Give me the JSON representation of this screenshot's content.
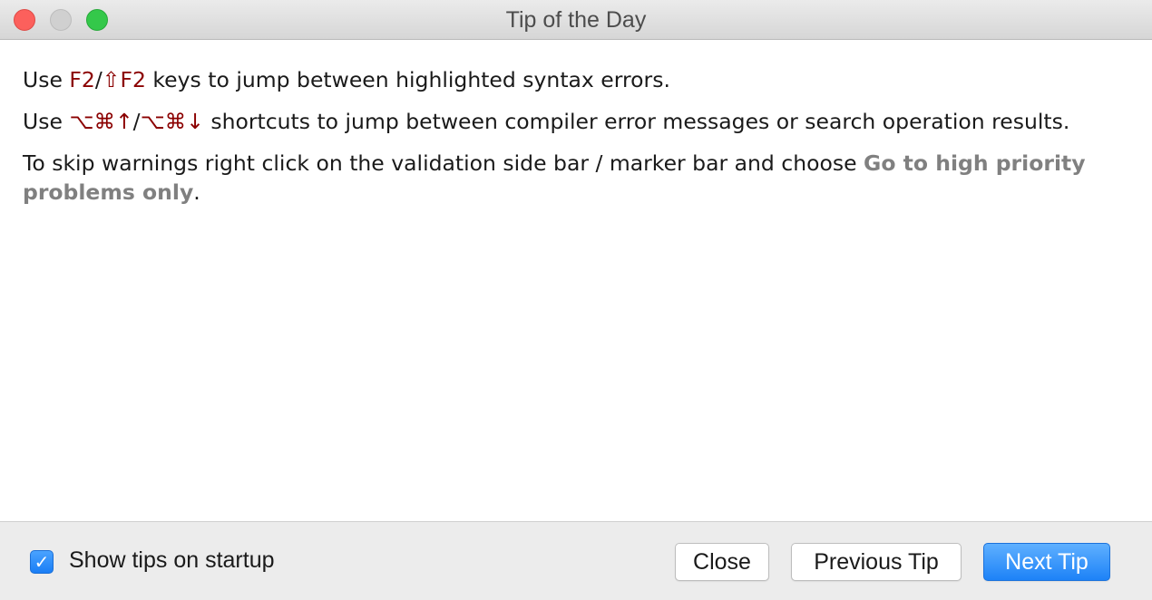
{
  "window": {
    "title": "Tip of the Day"
  },
  "tip": {
    "line1": {
      "prefix": "Use ",
      "key1": "F2",
      "sep": "/",
      "key2": "⇧F2",
      "suffix": " keys to jump between highlighted syntax errors."
    },
    "line2": {
      "prefix": "Use ",
      "key1": "⌥⌘↑",
      "sep": "/",
      "key2": "⌥⌘↓",
      "suffix": " shortcuts to jump between compiler error messages or search operation results."
    },
    "line3": {
      "prefix": "To skip warnings right click on the validation side bar / marker bar and choose ",
      "action": "Go to high priority problems only",
      "suffix": "."
    }
  },
  "footer": {
    "checkbox_checked": true,
    "checkbox_label": "Show tips on startup",
    "close_label": "Close",
    "previous_label": "Previous Tip",
    "next_label": "Next Tip"
  },
  "colors": {
    "key": "#8b0000",
    "action": "#808080",
    "primary_button": "#1d82f7"
  }
}
